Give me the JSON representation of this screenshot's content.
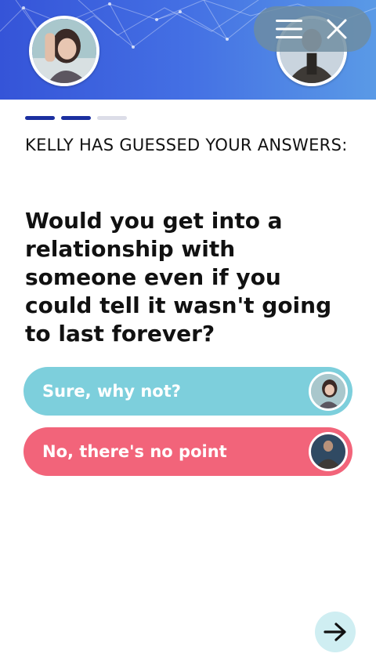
{
  "header": {
    "left_avatar": "kelly-avatar",
    "right_avatar": "partner-avatar",
    "menu_icon": "hamburger-menu-icon",
    "close_icon": "close-icon"
  },
  "progress": {
    "total_steps": 3,
    "completed_steps": 2
  },
  "content": {
    "heading": "KELLY HAS GUESSED YOUR ANSWERS:",
    "question": "Would you get into a relationship with someone even if you could tell it wasn't going to last forever?"
  },
  "answers": [
    {
      "label": "Sure, why not?",
      "color": "#7dcfdc",
      "avatar": "kelly-avatar"
    },
    {
      "label": "No, there's no point",
      "color": "#f2647a",
      "avatar": "partner-avatar"
    }
  ],
  "footer": {
    "next_icon": "arrow-right-icon"
  },
  "colors": {
    "header_gradient_start": "#3554d8",
    "header_gradient_end": "#5a9ae6",
    "progress_active": "#1b2fa0",
    "progress_inactive": "#dcdde8",
    "next_button_bg": "#cfeef2"
  }
}
